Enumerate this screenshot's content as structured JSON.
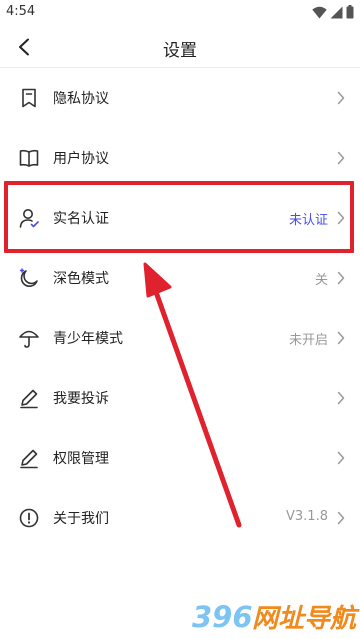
{
  "status_bar": {
    "time": "4:54",
    "icons": [
      "wifi-icon",
      "signal-icon",
      "battery-icon"
    ]
  },
  "nav": {
    "title": "设置",
    "back_icon": "chevron-left-icon"
  },
  "menu": [
    {
      "id": "privacy",
      "icon": "bookmark-icon",
      "label": "隐私协议",
      "value": ""
    },
    {
      "id": "user-agreement",
      "icon": "book-icon",
      "label": "用户协议",
      "value": ""
    },
    {
      "id": "real-name",
      "icon": "user-verified-icon",
      "label": "实名认证",
      "value": "未认证",
      "accent": "#4a4ee6"
    },
    {
      "id": "dark-mode",
      "icon": "moon-icon",
      "label": "深色模式",
      "value": "关"
    },
    {
      "id": "teen-mode",
      "icon": "umbrella-icon",
      "label": "青少年模式",
      "value": "未开启"
    },
    {
      "id": "complaint",
      "icon": "pencil-icon",
      "label": "我要投诉",
      "value": ""
    },
    {
      "id": "permissions",
      "icon": "pencil-icon",
      "label": "权限管理",
      "value": ""
    },
    {
      "id": "about",
      "icon": "info-icon",
      "label": "关于我们",
      "value": "V3.1.8"
    }
  ],
  "annotation": {
    "highlight_color": "#e0222e",
    "arrow_color": "#e0222e"
  },
  "watermark": {
    "text": "396网址导航",
    "logo_colors": [
      "#7cc4f2",
      "#f08a1c"
    ]
  }
}
